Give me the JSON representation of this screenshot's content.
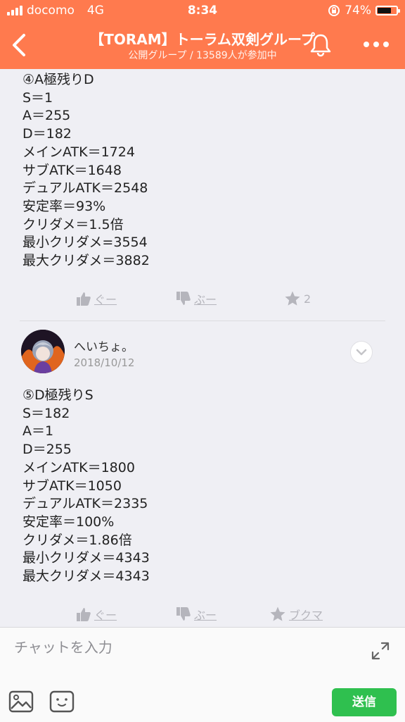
{
  "status": {
    "carrier": "docomo",
    "network": "4G",
    "time": "8:34",
    "battery": "74%",
    "battery_level": 0.74
  },
  "header": {
    "title": "【TORAM】トーラム双剣グループ",
    "subtitle": "公開グループ / 13589人が参加中"
  },
  "posts": [
    {
      "lines": [
        "④A極残りD",
        "S＝1",
        "A＝255",
        "D＝182",
        "メインATK＝1724",
        "サブATK＝1648",
        "デュアルATK＝2548",
        "安定率＝93%",
        "クリダメ＝1.5倍",
        "最小クリダメ=3554",
        "最大クリダメ＝3882"
      ],
      "like_label": "ぐー",
      "dislike_label": "ぶー",
      "star_label": "2"
    },
    {
      "author": "へいちょ。",
      "date": "2018/10/12",
      "lines": [
        "⑤D極残りS",
        "S＝182",
        "A＝1",
        "D＝255",
        "メインATK＝1800",
        "サブATK＝1050",
        "デュアルATK＝2335",
        "安定率＝100%",
        "クリダメ＝1.86倍",
        "最小クリダメ＝4343",
        "最大クリダメ＝4343"
      ],
      "like_label": "ぐー",
      "dislike_label": "ぶー",
      "star_label": "ブクマ"
    }
  ],
  "composer": {
    "placeholder": "チャットを入力",
    "send_label": "送信"
  },
  "colors": {
    "header": "#ff7a4e",
    "send": "#2fc04f",
    "reaction": "#b5b5bc"
  }
}
